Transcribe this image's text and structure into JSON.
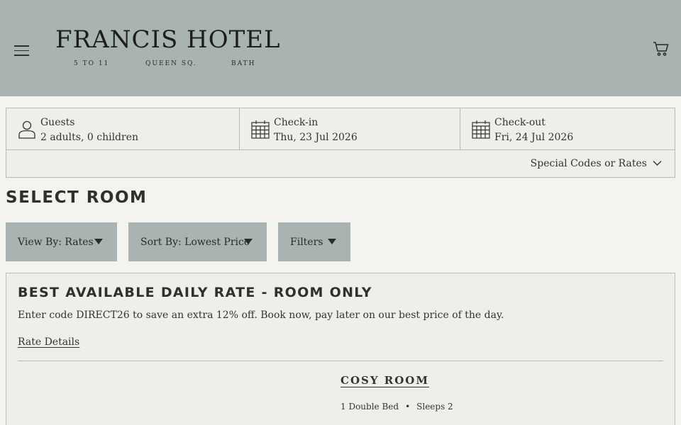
{
  "header": {
    "logo_title": "FRANCIS HOTEL",
    "logo_sub_1": "5 TO 11",
    "logo_sub_2": "QUEEN SQ.",
    "logo_sub_3": "BATH",
    "menu_icon": "hamburger-menu-icon",
    "cart_icon": "shopping-cart-icon",
    "background": "#a9b4b2"
  },
  "booking": {
    "guests_label": "Guests",
    "guests_value": "2 adults, 0 children",
    "checkin_label": "Check-in",
    "checkin_value": "Thu, 23 Jul 2026",
    "checkout_label": "Check-out",
    "checkout_value": "Fri, 24 Jul 2026",
    "special_codes": "Special Codes or Rates"
  },
  "section_title": "SELECT ROOM",
  "controls": {
    "view_by": "View By: Rates",
    "sort_by": "Sort By: Lowest Price",
    "filters": "Filters"
  },
  "rate": {
    "title": "BEST AVAILABLE DAILY RATE - ROOM ONLY",
    "description": "Enter code DIRECT26 to save an extra 12% off. Book now, pay later on our best price of the day.",
    "details_link": "Rate Details",
    "room": {
      "name": "COSY ROOM",
      "bed": "1 Double Bed",
      "separator": "•",
      "sleeps": "Sleeps 2"
    }
  }
}
